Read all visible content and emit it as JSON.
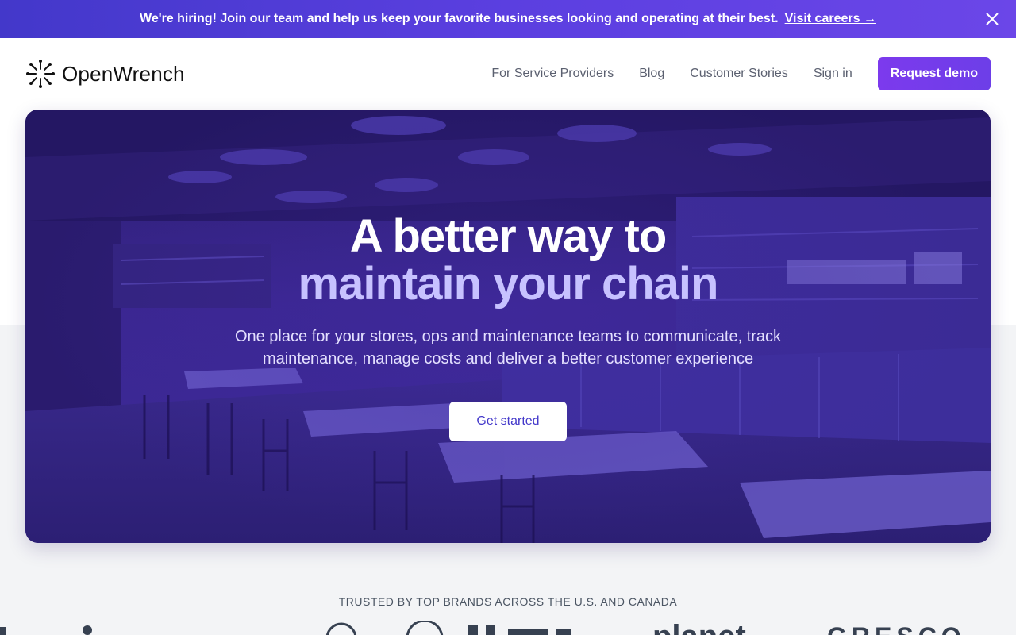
{
  "banner": {
    "message": "We're hiring! Join our team and help us keep your favorite businesses looking and operating at their best.",
    "cta": "Visit careers →",
    "close_icon": "close-icon"
  },
  "nav": {
    "logo_text": "OpenWrench",
    "logo_icon": "burst-logo-icon",
    "links": [
      "For Service Providers",
      "Blog",
      "Customer Stories",
      "Sign in"
    ],
    "demo_button": "Request demo"
  },
  "hero": {
    "title_line1": "A better way to",
    "title_line2": "maintain your chain",
    "subtitle": "One place for your stores, ops and maintenance teams to communicate, track maintenance, manage costs and deliver a better customer experience",
    "button": "Get started",
    "background": "restaurant-interior-image"
  },
  "trusted": {
    "label": "TRUSTED BY TOP BRANDS ACROSS THE U.S. AND CANADA",
    "brands": [
      "planet",
      "GRESCO"
    ]
  },
  "colors": {
    "accent": "#7c3aed",
    "banner": "#4f46e5",
    "hero_overlay": "#3a2690"
  }
}
